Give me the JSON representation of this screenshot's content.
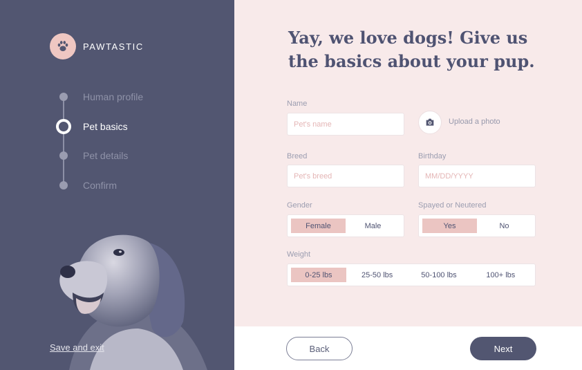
{
  "brand": {
    "name": "PAWTASTIC",
    "logo_icon": "paw-icon"
  },
  "steps": [
    {
      "label": "Human profile",
      "state": "done"
    },
    {
      "label": "Pet basics",
      "state": "active"
    },
    {
      "label": "Pet details",
      "state": "upcoming"
    },
    {
      "label": "Confirm",
      "state": "upcoming"
    }
  ],
  "sidebar": {
    "save_exit_label": "Save and exit"
  },
  "main": {
    "headline_line1": "Yay, we love dogs! Give us",
    "headline_line2": "the basics about your pup."
  },
  "form": {
    "name": {
      "label": "Name",
      "placeholder": "Pet's name",
      "value": ""
    },
    "upload": {
      "label": "Upload a photo",
      "icon": "camera-icon"
    },
    "breed": {
      "label": "Breed",
      "placeholder": "Pet's breed",
      "value": ""
    },
    "birthday": {
      "label": "Birthday",
      "placeholder": "MM/DD/YYYY",
      "value": ""
    },
    "gender": {
      "label": "Gender",
      "options": [
        "Female",
        "Male"
      ],
      "selected": "Female"
    },
    "spayed": {
      "label": "Spayed or Neutered",
      "options": [
        "Yes",
        "No"
      ],
      "selected": "Yes"
    },
    "weight": {
      "label": "Weight",
      "options": [
        "0-25 lbs",
        "25-50 lbs",
        "50-100 lbs",
        "100+ lbs"
      ],
      "selected": "0-25 lbs"
    }
  },
  "footer": {
    "back_label": "Back",
    "next_label": "Next"
  },
  "colors": {
    "sidebar_bg": "#525671",
    "main_bg": "#f8eaea",
    "accent_pink": "#ebc5c2",
    "heading": "#4f5372"
  }
}
